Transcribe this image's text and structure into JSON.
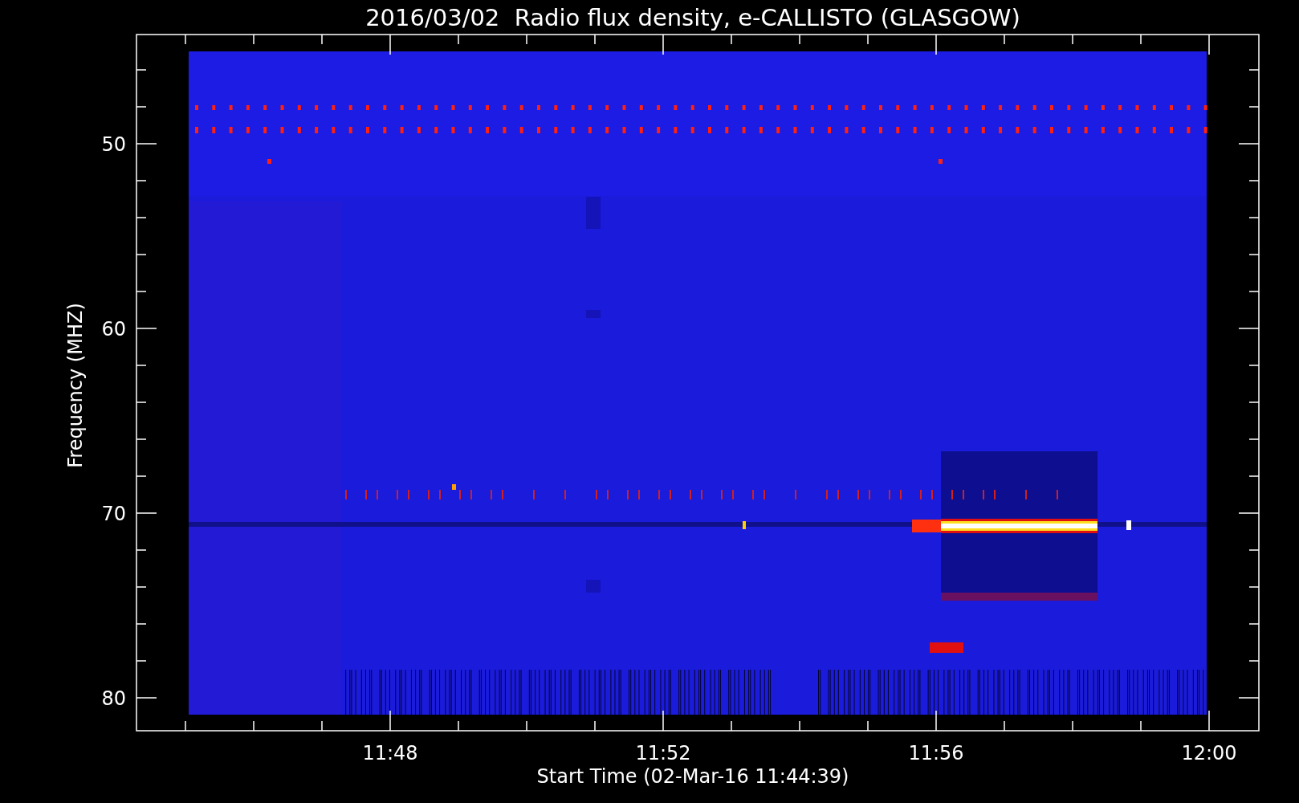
{
  "plot": {
    "title": "2016/03/02  Radio flux density, e-CALLISTO (GLASGOW)",
    "ylabel": "Frequency (MHZ)",
    "xlabel": "Start Time (02-Mar-16 11:44:39)",
    "yticks": [
      "50",
      "60",
      "70",
      "80"
    ],
    "xticks": [
      "11:48",
      "11:52",
      "11:56",
      "12:00"
    ]
  }
}
